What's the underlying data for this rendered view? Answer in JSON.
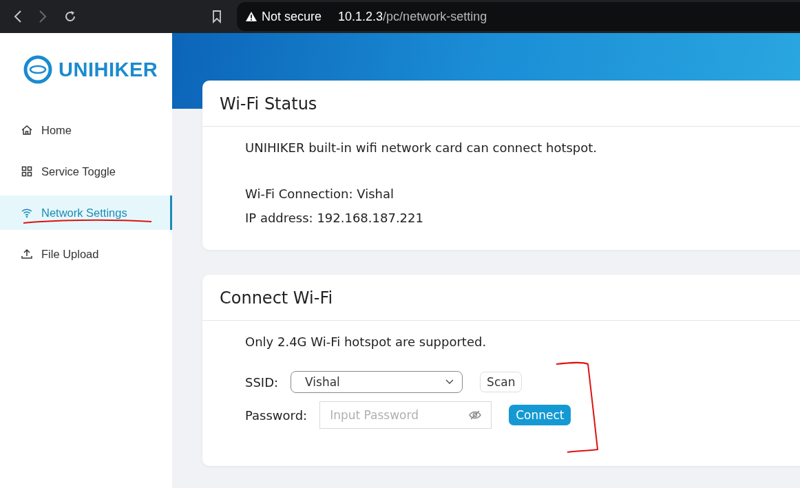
{
  "browser": {
    "security": "Not secure",
    "url_host": "10.1.2.3",
    "url_path": "/pc/network-setting"
  },
  "sidebar": {
    "logo": "UNIHIKER",
    "items": [
      {
        "kind": "home",
        "label": "Home",
        "selected": false
      },
      {
        "kind": "grid",
        "label": "Service Toggle",
        "selected": false
      },
      {
        "kind": "wifi",
        "label": "Network Settings",
        "selected": true
      },
      {
        "kind": "upload",
        "label": "File Upload",
        "selected": false
      }
    ]
  },
  "wifi_status": {
    "title": "Wi-Fi Status",
    "description": "UNIHIKER built-in wifi network card can connect hotspot.",
    "lines": [
      "Wi-Fi Connection: Vishal",
      "IP address: 192.168.187.221"
    ]
  },
  "connect_wifi": {
    "title": "Connect Wi-Fi",
    "note": "Only 2.4G Wi-Fi hotspot are supported.",
    "ssid": {
      "label": "SSID:",
      "value": "Vishal"
    },
    "scan_button": "Scan",
    "password": {
      "label": "Password:",
      "placeholder": "Input Password"
    },
    "connect_button": "Connect"
  }
}
